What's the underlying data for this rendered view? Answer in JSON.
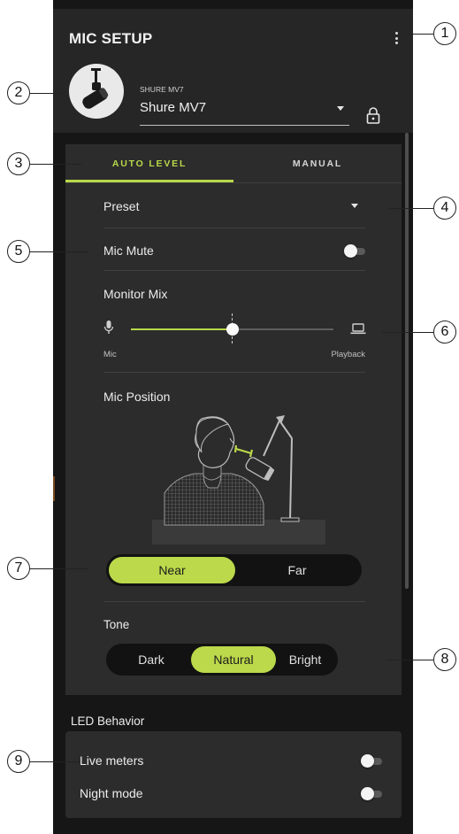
{
  "header": {
    "title": "MIC SETUP",
    "device_caption": "SHURE MV7",
    "device_value": "Shure MV7"
  },
  "tabs": [
    {
      "label": "AUTO LEVEL",
      "active": true
    },
    {
      "label": "MANUAL",
      "active": false
    }
  ],
  "auto_level": {
    "preset_label": "Preset",
    "mic_mute_label": "Mic Mute",
    "mic_mute_on": false,
    "monitor_mix": {
      "label": "Monitor Mix",
      "left_label": "Mic",
      "right_label": "Playback",
      "value_fraction": 0.5
    },
    "mic_position": {
      "label": "Mic Position",
      "options": [
        "Near",
        "Far"
      ],
      "selected": "Near"
    },
    "tone": {
      "label": "Tone",
      "options": [
        "Dark",
        "Natural",
        "Bright"
      ],
      "selected": "Natural"
    }
  },
  "led": {
    "title": "LED Behavior",
    "live_meters_label": "Live meters",
    "live_meters_on": false,
    "night_mode_label": "Night mode",
    "night_mode_on": false
  },
  "callouts": [
    "1",
    "2",
    "3",
    "4",
    "5",
    "6",
    "7",
    "8",
    "9"
  ],
  "colors": {
    "accent": "#b8d94a",
    "panel": "#2c2c2c",
    "background": "#161616"
  }
}
